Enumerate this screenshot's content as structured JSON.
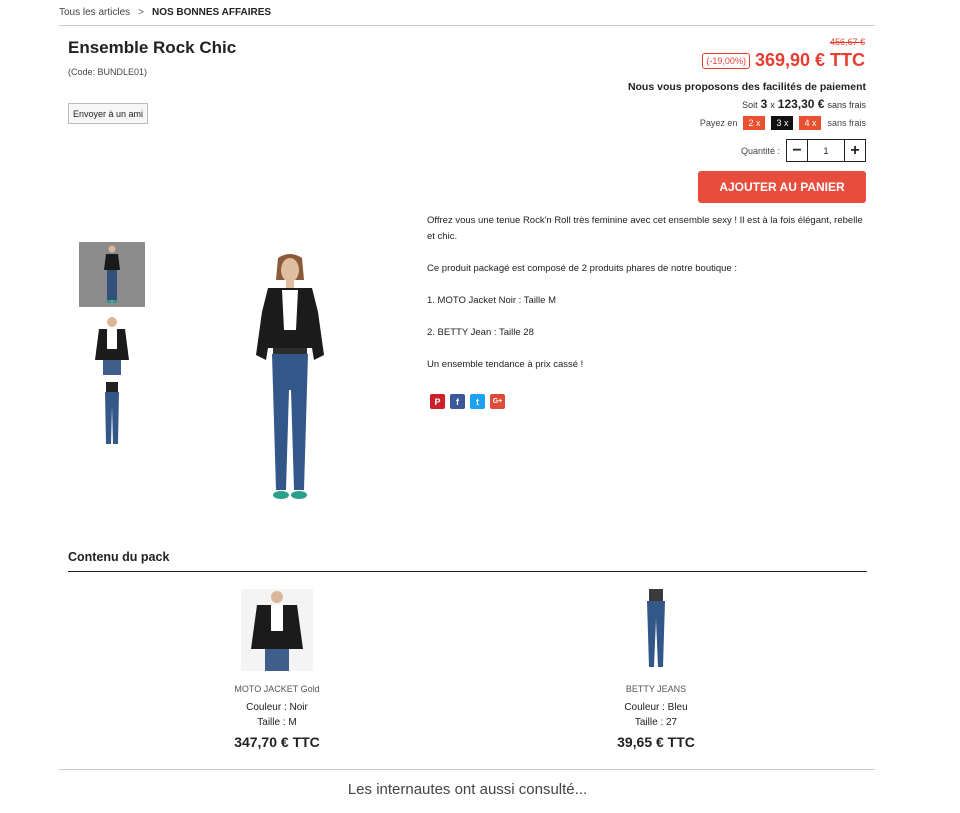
{
  "breadcrumb": {
    "root": "Tous les articles",
    "separator": ">",
    "current": "NOS BONNES AFFAIRES"
  },
  "product": {
    "title": "Ensemble Rock Chic",
    "code": "(Code: BUNDLE01)",
    "send_friend": "Envoyer à un ami",
    "old_price": "456,67 €",
    "discount": "(-19,00%)",
    "price": "369,90 € TTC"
  },
  "payment": {
    "title": "Nous vous proposons des facilités de paiement",
    "soit": "Soit",
    "times": "3",
    "x": "x",
    "amount": "123,30 €",
    "no_fee": "sans frais",
    "payez_en": "Payez en",
    "options": [
      "2 x",
      "3 x",
      "4 x"
    ],
    "options_no_fee": "sans frais"
  },
  "quantity": {
    "label": "Quantité :",
    "minus": "−",
    "value": "1",
    "plus": "+"
  },
  "add_to_cart": "AJOUTER AU PANIER",
  "description": [
    "Offrez vous une tenue Rock'n Roll très feminine avec cet ensemble sexy ! Il est à la fois élégant, rebelle et chic.",
    "Ce produit packagé est composé de 2 produits phares de notre boutique :",
    "1. MOTO Jacket Noir : Taille M",
    "2. BETTY Jean : Taille 28",
    "Un ensemble tendance à prix cassé !"
  ],
  "social": [
    {
      "icon": "pinterest-icon",
      "glyph": "P",
      "color": "#cb2027"
    },
    {
      "icon": "facebook-icon",
      "glyph": "f",
      "color": "#3b5998"
    },
    {
      "icon": "twitter-icon",
      "glyph": "t",
      "color": "#1da1f2"
    },
    {
      "icon": "googleplus-icon",
      "glyph": "G+",
      "color": "#dd4b39"
    }
  ],
  "pack": {
    "title": "Contenu du pack",
    "items": [
      {
        "name": "MOTO JACKET Gold",
        "color": "Couleur : Noir",
        "size": "Taille : M",
        "price": "347,70 € TTC"
      },
      {
        "name": "BETTY JEANS",
        "color": "Couleur : Bleu",
        "size": "Taille : 27",
        "price": "39,65 € TTC"
      }
    ]
  },
  "also_viewed": "Les internautes ont aussi consulté...",
  "colors": {
    "accent": "#e74c3c",
    "price": "#e53e30"
  }
}
